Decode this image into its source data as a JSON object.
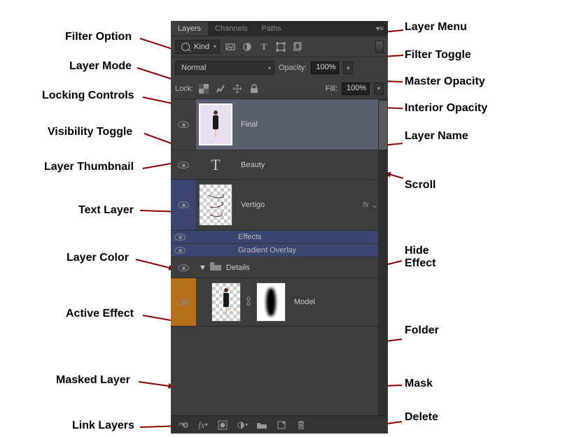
{
  "tabs": {
    "layers": "Layers",
    "channels": "Channels",
    "paths": "Paths"
  },
  "filter": {
    "kind": "Kind"
  },
  "mode": {
    "normal": "Normal",
    "opacity_label": "Opacity:",
    "opacity_value": "100%"
  },
  "lock": {
    "label": "Lock:",
    "fill_label": "Fill:",
    "fill_value": "100%"
  },
  "layers": {
    "final": "Final",
    "beauty": "Beauty",
    "vertigo": "Vertigo",
    "effects": "Effects",
    "gradient_overlay": "Gradient Overlay",
    "details": "Details",
    "model": "Model",
    "fx": "fx"
  },
  "annotations": {
    "filter_option": "Filter Option",
    "layer_mode": "Layer Mode",
    "locking_controls": "Locking Controls",
    "visibility_toggle": "Visibility Toggle",
    "layer_thumbnail": "Layer Thumbnail",
    "text_layer": "Text Layer",
    "layer_color": "Layer Color",
    "active_effect": "Active Effect",
    "masked_layer": "Masked Layer",
    "link_layers": "Link Layers",
    "layer_menu": "Layer Menu",
    "filter_toggle": "Filter Toggle",
    "master_opacity": "Master Opacity",
    "interior_opacity": "Interior Opacity",
    "layer_name": "Layer Name",
    "scroll": "Scroll",
    "hide_effect": "Hide\nEffect",
    "folder": "Folder",
    "mask": "Mask",
    "delete": "Delete"
  }
}
